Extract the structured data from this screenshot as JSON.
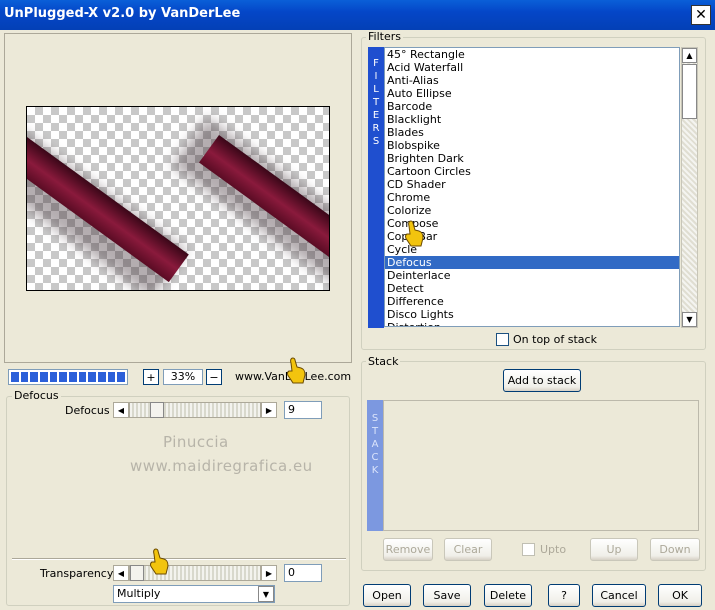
{
  "window": {
    "title": "UnPlugged-X v2.0 by VanDerLee",
    "close_glyph": "✕"
  },
  "preview": {
    "zoom_in": "+",
    "zoom_out": "−",
    "zoom_value": "33%",
    "website": "www.VanDerLee.com"
  },
  "defocus_group": {
    "title": "Defocus",
    "defocus_label": "Defocus",
    "defocus_value": "9",
    "watermark_line1": "Pinuccia",
    "watermark_line2": "www.maidiregrafica.eu",
    "transparency_label": "Transparency",
    "transparency_value": "0",
    "blend_mode": "Multiply"
  },
  "filters": {
    "title": "Filters",
    "side_label": [
      "F",
      "I",
      "L",
      "T",
      "E",
      "R",
      "S"
    ],
    "items": [
      "45° Rectangle",
      "Acid Waterfall",
      "Anti-Alias",
      "Auto Ellipse",
      "Barcode",
      "Blacklight",
      "Blades",
      "Blobspike",
      "Brighten Dark",
      "Cartoon Circles",
      "CD Shader",
      "Chrome",
      "Colorize",
      "Compose",
      "Copy Bar",
      "Cycle",
      "Defocus",
      "Deinterlace",
      "Detect",
      "Difference",
      "Disco Lights",
      "Distortion"
    ],
    "selected": "Defocus",
    "on_top_label": "On top of stack"
  },
  "stack": {
    "title": "Stack",
    "add_label": "Add to stack",
    "side_label": [
      "S",
      "T",
      "A",
      "C",
      "K"
    ],
    "remove_label": "Remove",
    "clear_label": "Clear",
    "upto_label": "Upto",
    "up_label": "Up",
    "down_label": "Down"
  },
  "buttons": {
    "open": "Open",
    "save": "Save",
    "delete": "Delete",
    "help": "?",
    "cancel": "Cancel",
    "ok": "OK"
  },
  "icons": {
    "scroll_up": "▲",
    "scroll_down": "▼",
    "slider_left": "◀",
    "slider_right": "▶",
    "dropdown": "▼"
  },
  "colors": {
    "titlebar": "#0446c8",
    "selection": "#316ac5",
    "filters_strip": "#1f4fcf",
    "stack_strip": "#7c98e0",
    "hand": "#f2c40e"
  }
}
